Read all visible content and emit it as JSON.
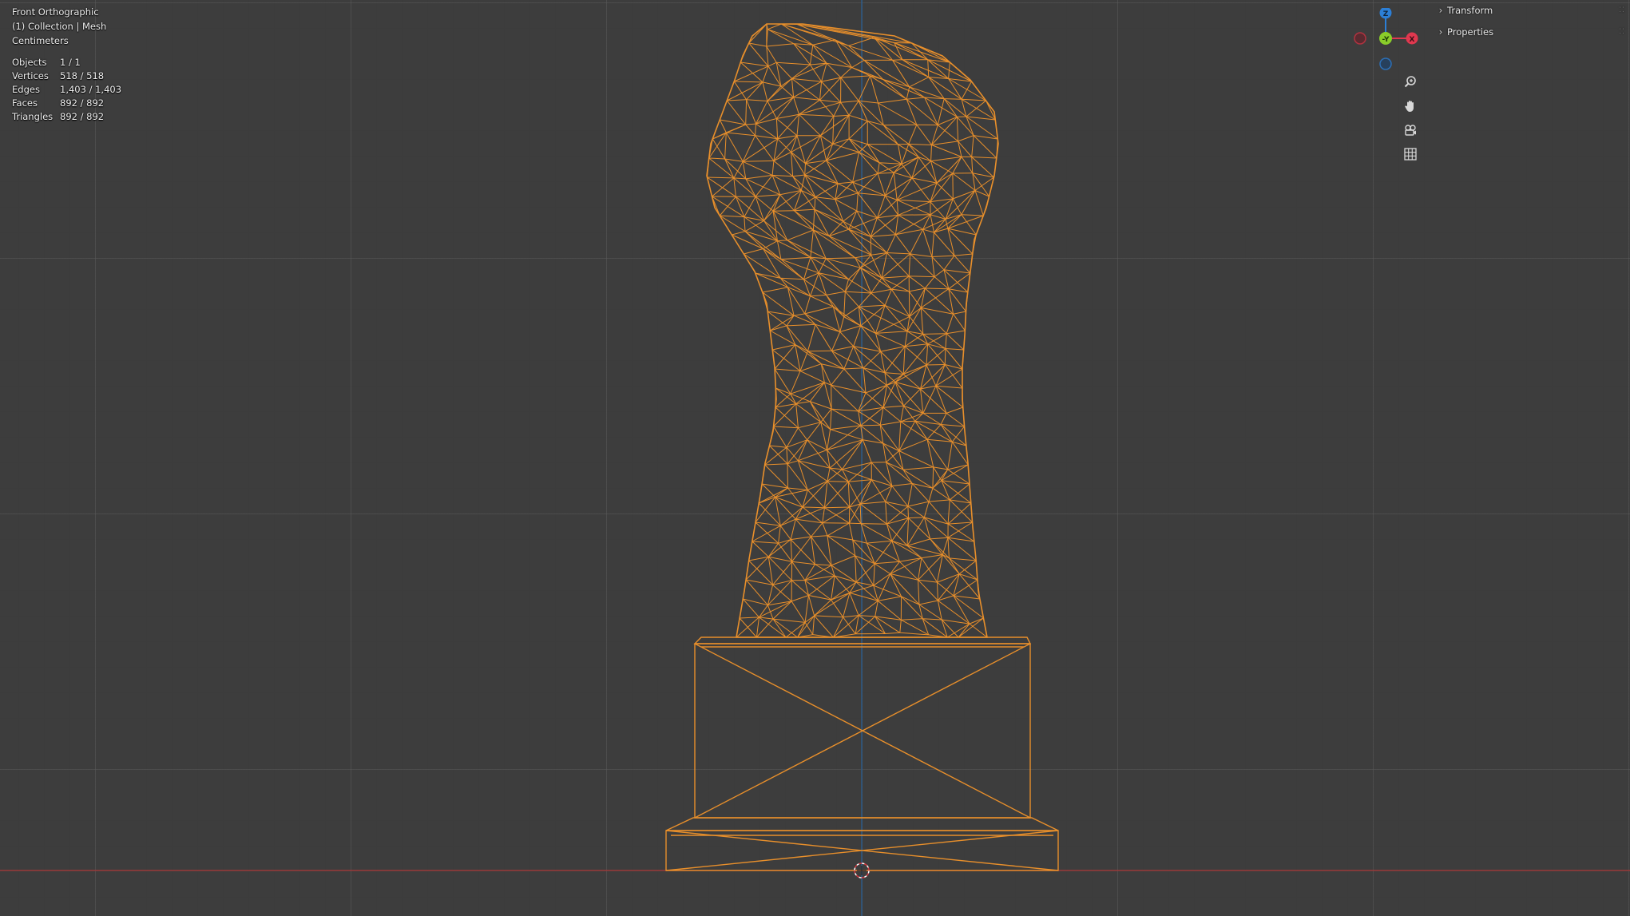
{
  "viewport": {
    "view_name": "Front Orthographic",
    "collection_line": "(1) Collection | Mesh",
    "units": "Centimeters"
  },
  "stats": [
    {
      "label": "Objects",
      "value": "1 / 1"
    },
    {
      "label": "Vertices",
      "value": "518 / 518"
    },
    {
      "label": "Edges",
      "value": "1,403 / 1,403"
    },
    {
      "label": "Faces",
      "value": "892 / 892"
    },
    {
      "label": "Triangles",
      "value": "892 / 892"
    }
  ],
  "gizmo": {
    "z_label": "Z",
    "y_label": "-Y",
    "x_label": "X",
    "colors": {
      "x": "#e0384f",
      "y": "#8acd2a",
      "z": "#2c7fd6"
    }
  },
  "nav_buttons": [
    {
      "icon": "zoom-icon",
      "glyph": "⚲"
    },
    {
      "icon": "hand-pan-icon",
      "glyph": "✋"
    },
    {
      "icon": "camera-view-icon",
      "glyph": "⦿"
    },
    {
      "icon": "grid-ortho-icon",
      "glyph": "▦"
    }
  ],
  "sidebar": {
    "items": [
      {
        "label": "Transform"
      },
      {
        "label": "Properties"
      }
    ]
  },
  "colors": {
    "wire": "#e88f2b",
    "x_axis": "#9a3a3a",
    "z_axis": "#2d5a86"
  }
}
